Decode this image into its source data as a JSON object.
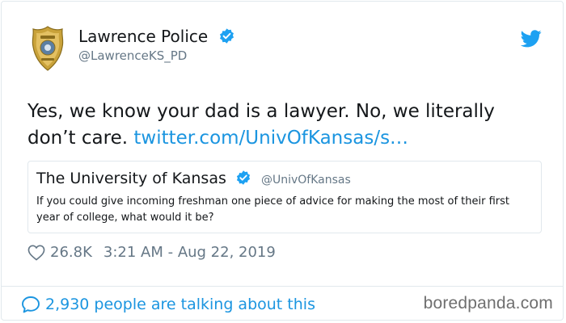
{
  "account": {
    "display_name": "Lawrence Police",
    "handle": "@LawrenceKS_PD",
    "verified": true,
    "logo_icon": "police-badge-icon"
  },
  "tweet": {
    "text": "Yes, we know your dad is a lawyer. No, we literally don’t care.",
    "link": "twitter.com/UnivOfKansas/s…",
    "likes": "26.8K",
    "timestamp": "3:21 AM - Aug 22, 2019"
  },
  "quoted_tweet": {
    "display_name": "The University of Kansas",
    "handle": "@UnivOfKansas",
    "verified": true,
    "text": "If you could give incoming freshman one piece of advice for making the most of their first year of college, what would it be?"
  },
  "footer": {
    "talking": "2,930 people are talking about this",
    "watermark": "boredpanda.com"
  },
  "colors": {
    "accent": "#1b95e0",
    "verified": "#1da1f2",
    "muted": "#657786",
    "border": "#e1e8ed"
  }
}
